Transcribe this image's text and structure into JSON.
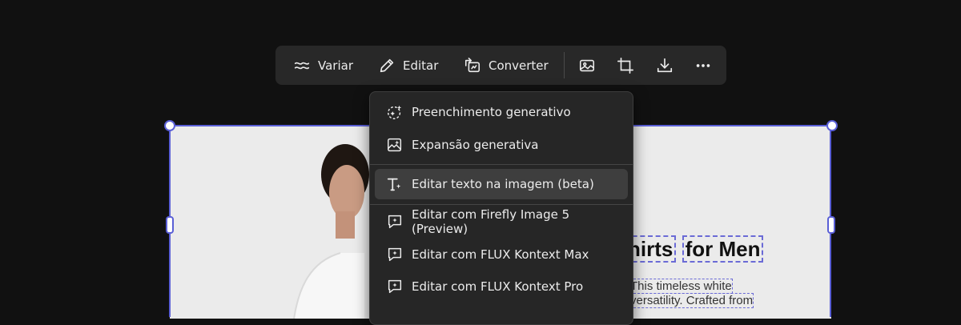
{
  "toolbar": {
    "variar_label": "Variar",
    "editar_label": "Editar",
    "converter_label": "Converter",
    "icons": [
      "image-icon",
      "crop-icon",
      "download-icon",
      "more-icon"
    ]
  },
  "menu": {
    "items": [
      {
        "label": "Preenchimento generativo",
        "icon": "generative-fill-icon"
      },
      {
        "label": "Expansão generativa",
        "icon": "generative-expand-icon"
      },
      {
        "label": "Editar texto na imagem (beta)",
        "icon": "edit-text-icon",
        "active": true
      },
      {
        "label": "Editar com Firefly Image 5 (Preview)",
        "icon": "ai-chat-edit-icon"
      },
      {
        "label": "Editar com FLUX Kontext Max",
        "icon": "ai-chat-edit-icon"
      },
      {
        "label": "Editar com FLUX Kontext Pro",
        "icon": "ai-chat-edit-icon"
      }
    ]
  },
  "image_text": {
    "title_part1": "hirts",
    "title_part2": "for Men",
    "body_line1": "This timeless white",
    "body_line2": "versatility. Crafted from"
  },
  "colors": {
    "background": "#111111",
    "toolbar": "#282828",
    "menu": "#262626",
    "menu_active": "#3e3e3e",
    "selection": "#5a5fd6"
  }
}
